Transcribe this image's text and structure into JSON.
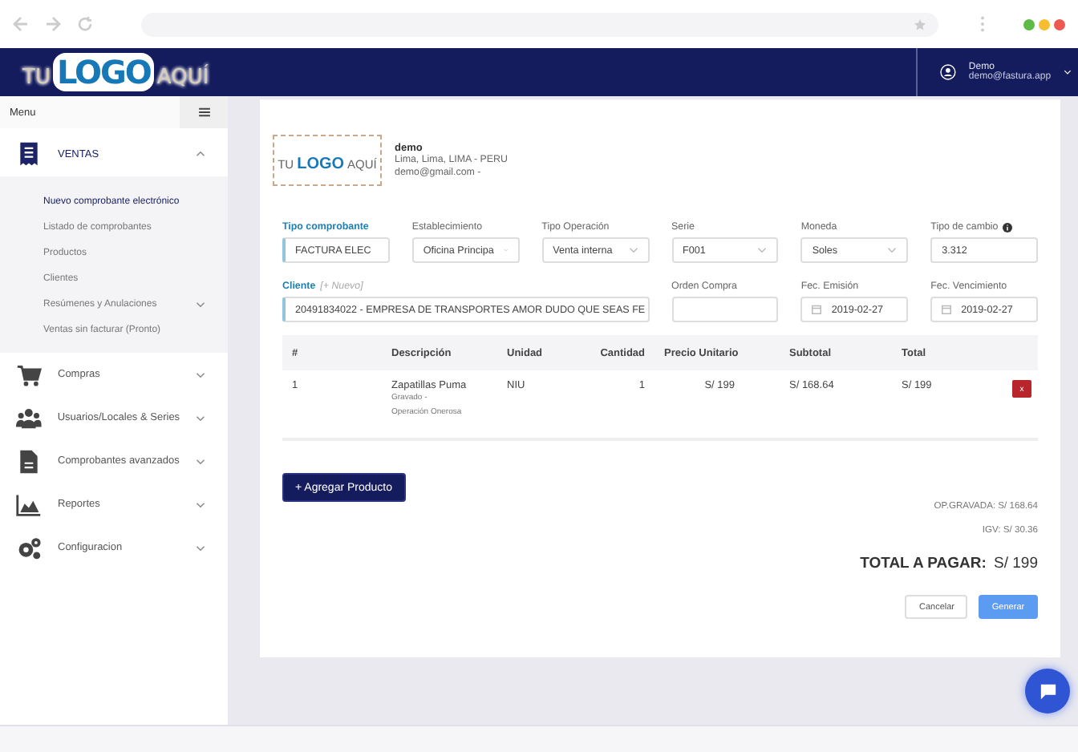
{
  "header": {
    "logo": [
      "TU",
      "LOGO",
      "AQUÍ"
    ],
    "user": {
      "name": "Demo",
      "email": "demo@fastura.app"
    }
  },
  "sidebar": {
    "title": "Menu",
    "items": [
      {
        "label": "VENTAS",
        "expanded": true,
        "children": [
          {
            "label": "Nuevo comprobante electrónico",
            "selected": true,
            "has_submenu": false
          },
          {
            "label": "Listado de comprobantes",
            "selected": false,
            "has_submenu": false
          },
          {
            "label": "Productos",
            "selected": false,
            "has_submenu": false
          },
          {
            "label": "Clientes",
            "selected": false,
            "has_submenu": false
          },
          {
            "label": "Resúmenes y Anulaciones",
            "selected": false,
            "has_submenu": true
          },
          {
            "label": "Ventas sin facturar (Pronto)",
            "selected": false,
            "has_submenu": false
          }
        ]
      },
      {
        "label": "Compras",
        "expanded": false
      },
      {
        "label": "Usuarios/Locales & Series",
        "expanded": false
      },
      {
        "label": "Comprobantes avanzados",
        "expanded": false
      },
      {
        "label": "Reportes",
        "expanded": false
      },
      {
        "label": "Configuracion",
        "expanded": false
      }
    ]
  },
  "company": {
    "logo": [
      "TU",
      "LOGO",
      "AQUÍ"
    ],
    "name": "demo",
    "address": "Lima, Lima, LIMA - PERU",
    "email": "demo@gmail.com -"
  },
  "fields": [
    {
      "label": "Tipo comprobante",
      "kind": "select",
      "value": "FACTURA ELEC",
      "active": true
    },
    {
      "label": "Establecimiento",
      "kind": "select",
      "value": "Oficina Principa",
      "active": false
    },
    {
      "label": "Tipo Operación",
      "kind": "select",
      "value": "Venta interna",
      "active": false
    },
    {
      "label": "Serie",
      "kind": "select",
      "value": "F001",
      "active": false
    },
    {
      "label": "Moneda",
      "kind": "select",
      "value": "Soles",
      "active": false
    },
    {
      "label": "Tipo de cambio",
      "kind": "input",
      "value": "3.312",
      "active": false,
      "info": true
    },
    {
      "label": "Cliente",
      "link": "[+ Nuevo]",
      "kind": "client",
      "value": "20491834022 - EMPRESA DE TRANSPORTES AMOR DUDO QUE SEAS FE",
      "active": true
    },
    {
      "label": "Orden Compra",
      "kind": "input",
      "active": false
    },
    {
      "label": "Fec. Emisión",
      "kind": "date",
      "value": "2019-02-27",
      "active": false
    },
    {
      "label": "Fec. Vencimiento",
      "kind": "date",
      "value": "2019-02-27",
      "active": false
    }
  ],
  "table": {
    "columns": [
      "#",
      "Descripción",
      "Unidad",
      "Cantidad",
      "Precio Unitario",
      "Subtotal",
      "Total"
    ],
    "rows": [
      {
        "number": "1",
        "description": "Zapatillas Puma",
        "notes": [
          "Gravado -",
          "Operación Onerosa"
        ],
        "unit": "NIU",
        "quantity": "1",
        "unit_price": "S/ 199",
        "subtotal": "S/ 168.64",
        "total": "S/ 199",
        "delete": "x"
      }
    ]
  },
  "add_button": "+ Agregar Producto",
  "totals": [
    "OP.GRAVADA: S/ 168.64",
    "IGV: S/ 30.36"
  ],
  "grand_total": {
    "label": "TOTAL A PAGAR:",
    "value": "S/ 199"
  },
  "actions": {
    "cancel": "Cancelar",
    "submit": "Generar"
  }
}
